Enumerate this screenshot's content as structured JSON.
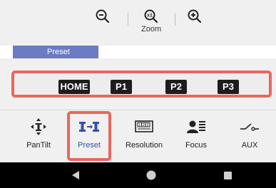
{
  "zoom": {
    "zoom_out_icon": "zoom-out-icon",
    "zoom_reset_icon": "zoom-reset-icon",
    "zoom_in_icon": "zoom-in-icon",
    "label": "Zoom"
  },
  "tab": {
    "label": "Preset"
  },
  "presets": [
    {
      "label": "HOME"
    },
    {
      "label": "P1"
    },
    {
      "label": "P2"
    },
    {
      "label": "P3"
    }
  ],
  "nav": [
    {
      "label": "PanTilt",
      "icon": "pantilt-icon"
    },
    {
      "label": "Preset",
      "icon": "preset-icon",
      "selected": true
    },
    {
      "label": "Resolution",
      "icon": "resolution-icon"
    },
    {
      "label": "Focus",
      "icon": "focus-icon"
    },
    {
      "label": "AUX",
      "icon": "aux-switch-icon"
    }
  ],
  "system_nav": {
    "back": "back-icon",
    "home": "home-icon",
    "recents": "recents-icon"
  },
  "colors": {
    "accent": "#6b7bc4",
    "highlight": "#e8675f",
    "selected": "#3a4fa8"
  }
}
